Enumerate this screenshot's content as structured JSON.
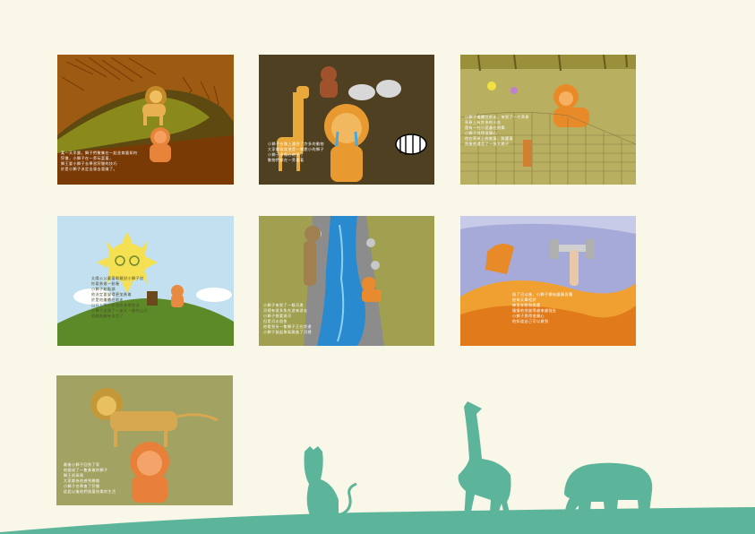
{
  "colors": {
    "background": "#f8f7e8",
    "silhouette": "#5cb59a"
  },
  "pages": [
    {
      "caption": "某一天早晨，獅子們聚集在一起並商量如何\n狩獵，小獅子在一旁玩耍著，\n獅王要小獅子去學習狩獵的技巧\n於是小獅子決定出發去冒險了。",
      "scene": "lion-on-rock"
    },
    {
      "caption": "小獅子在路上遇到了許多的動物\n大家都取笑他是一隻膽小的獅子\n小獅子很傷心地哭了\n動物們都在一旁看著",
      "scene": "crying-lion-animals"
    },
    {
      "caption": "小獅子繼續往前走，來到了一片草原\n草原上有許多的小花\n還有一些小昆蟲在飛舞\n小獅子覺得很開心\n他在草原上奔跑著，跳躍著\n然後他遇見了一張大網子",
      "scene": "lion-fence"
    },
    {
      "caption": "太陽公公戴著眼鏡對小獅子說\n你要勇敢一點喔\n小獅子點點頭\n他決定要變得更加勇敢\n於是他繼續往前走\n山丘上的小花也在為他加油\n小獅子走過了一座又一座的山丘\n他越來越有自信了",
      "scene": "sun-hill"
    },
    {
      "caption": "小獅子來到了一條河邊\n河裡有很多魚在游來游去\n小獅子想要過河\n但是河水很急\n他看到另一隻獅子正在岸邊\n小獅子鼓起勇氣跳進了河裡",
      "scene": "river-crossing"
    },
    {
      "caption": "過了河以後，小獅子開始鍛鍊身體\n他每天舉啞鈴\n練習奔跑和跳躍\n慢慢地他變得越來越強壯\n小獅子覺得很開心\n他知道自己可以做到",
      "scene": "training"
    },
    {
      "caption": "最後小獅子回到了家\n他變成了一隻勇敢的獅子\n獅王很高興\n大家都為他感到驕傲\n小獅子也學會了狩獵\n從此以後他們過著快樂的生活",
      "scene": "return-home"
    }
  ]
}
